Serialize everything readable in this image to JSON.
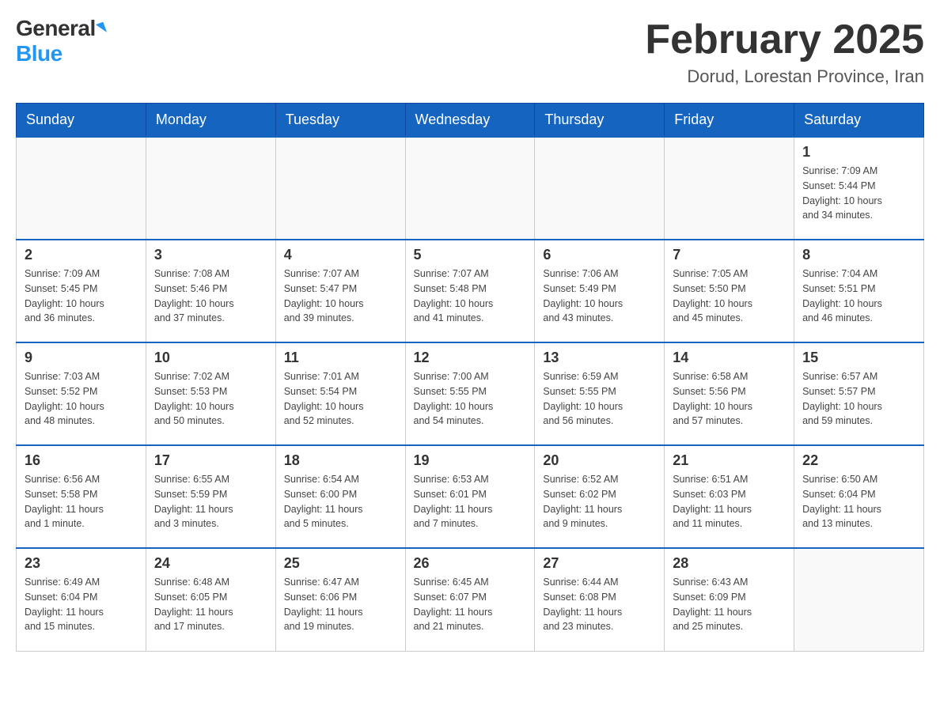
{
  "logo": {
    "general": "General",
    "blue": "Blue"
  },
  "title": {
    "month_year": "February 2025",
    "location": "Dorud, Lorestan Province, Iran"
  },
  "days_of_week": [
    "Sunday",
    "Monday",
    "Tuesday",
    "Wednesday",
    "Thursday",
    "Friday",
    "Saturday"
  ],
  "weeks": [
    [
      {
        "day": "",
        "info": ""
      },
      {
        "day": "",
        "info": ""
      },
      {
        "day": "",
        "info": ""
      },
      {
        "day": "",
        "info": ""
      },
      {
        "day": "",
        "info": ""
      },
      {
        "day": "",
        "info": ""
      },
      {
        "day": "1",
        "info": "Sunrise: 7:09 AM\nSunset: 5:44 PM\nDaylight: 10 hours\nand 34 minutes."
      }
    ],
    [
      {
        "day": "2",
        "info": "Sunrise: 7:09 AM\nSunset: 5:45 PM\nDaylight: 10 hours\nand 36 minutes."
      },
      {
        "day": "3",
        "info": "Sunrise: 7:08 AM\nSunset: 5:46 PM\nDaylight: 10 hours\nand 37 minutes."
      },
      {
        "day": "4",
        "info": "Sunrise: 7:07 AM\nSunset: 5:47 PM\nDaylight: 10 hours\nand 39 minutes."
      },
      {
        "day": "5",
        "info": "Sunrise: 7:07 AM\nSunset: 5:48 PM\nDaylight: 10 hours\nand 41 minutes."
      },
      {
        "day": "6",
        "info": "Sunrise: 7:06 AM\nSunset: 5:49 PM\nDaylight: 10 hours\nand 43 minutes."
      },
      {
        "day": "7",
        "info": "Sunrise: 7:05 AM\nSunset: 5:50 PM\nDaylight: 10 hours\nand 45 minutes."
      },
      {
        "day": "8",
        "info": "Sunrise: 7:04 AM\nSunset: 5:51 PM\nDaylight: 10 hours\nand 46 minutes."
      }
    ],
    [
      {
        "day": "9",
        "info": "Sunrise: 7:03 AM\nSunset: 5:52 PM\nDaylight: 10 hours\nand 48 minutes."
      },
      {
        "day": "10",
        "info": "Sunrise: 7:02 AM\nSunset: 5:53 PM\nDaylight: 10 hours\nand 50 minutes."
      },
      {
        "day": "11",
        "info": "Sunrise: 7:01 AM\nSunset: 5:54 PM\nDaylight: 10 hours\nand 52 minutes."
      },
      {
        "day": "12",
        "info": "Sunrise: 7:00 AM\nSunset: 5:55 PM\nDaylight: 10 hours\nand 54 minutes."
      },
      {
        "day": "13",
        "info": "Sunrise: 6:59 AM\nSunset: 5:55 PM\nDaylight: 10 hours\nand 56 minutes."
      },
      {
        "day": "14",
        "info": "Sunrise: 6:58 AM\nSunset: 5:56 PM\nDaylight: 10 hours\nand 57 minutes."
      },
      {
        "day": "15",
        "info": "Sunrise: 6:57 AM\nSunset: 5:57 PM\nDaylight: 10 hours\nand 59 minutes."
      }
    ],
    [
      {
        "day": "16",
        "info": "Sunrise: 6:56 AM\nSunset: 5:58 PM\nDaylight: 11 hours\nand 1 minute."
      },
      {
        "day": "17",
        "info": "Sunrise: 6:55 AM\nSunset: 5:59 PM\nDaylight: 11 hours\nand 3 minutes."
      },
      {
        "day": "18",
        "info": "Sunrise: 6:54 AM\nSunset: 6:00 PM\nDaylight: 11 hours\nand 5 minutes."
      },
      {
        "day": "19",
        "info": "Sunrise: 6:53 AM\nSunset: 6:01 PM\nDaylight: 11 hours\nand 7 minutes."
      },
      {
        "day": "20",
        "info": "Sunrise: 6:52 AM\nSunset: 6:02 PM\nDaylight: 11 hours\nand 9 minutes."
      },
      {
        "day": "21",
        "info": "Sunrise: 6:51 AM\nSunset: 6:03 PM\nDaylight: 11 hours\nand 11 minutes."
      },
      {
        "day": "22",
        "info": "Sunrise: 6:50 AM\nSunset: 6:04 PM\nDaylight: 11 hours\nand 13 minutes."
      }
    ],
    [
      {
        "day": "23",
        "info": "Sunrise: 6:49 AM\nSunset: 6:04 PM\nDaylight: 11 hours\nand 15 minutes."
      },
      {
        "day": "24",
        "info": "Sunrise: 6:48 AM\nSunset: 6:05 PM\nDaylight: 11 hours\nand 17 minutes."
      },
      {
        "day": "25",
        "info": "Sunrise: 6:47 AM\nSunset: 6:06 PM\nDaylight: 11 hours\nand 19 minutes."
      },
      {
        "day": "26",
        "info": "Sunrise: 6:45 AM\nSunset: 6:07 PM\nDaylight: 11 hours\nand 21 minutes."
      },
      {
        "day": "27",
        "info": "Sunrise: 6:44 AM\nSunset: 6:08 PM\nDaylight: 11 hours\nand 23 minutes."
      },
      {
        "day": "28",
        "info": "Sunrise: 6:43 AM\nSunset: 6:09 PM\nDaylight: 11 hours\nand 25 minutes."
      },
      {
        "day": "",
        "info": ""
      }
    ]
  ]
}
